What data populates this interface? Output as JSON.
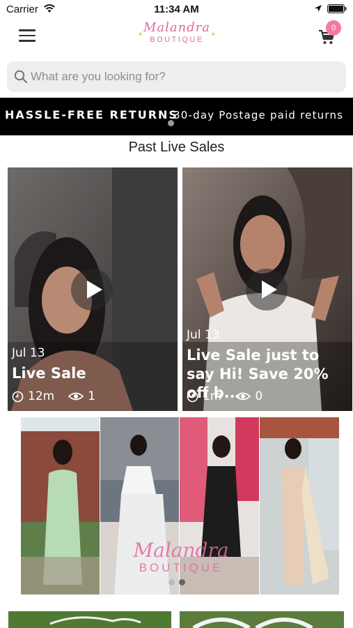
{
  "status": {
    "carrier": "Carrier",
    "time": "11:34 AM"
  },
  "header": {
    "logo_script": "Malandra",
    "logo_word": "BOUTIQUE",
    "cart_count": "0"
  },
  "search": {
    "placeholder": "What are you looking for?"
  },
  "banner": {
    "headline": "HASSLE-FREE RETURNS",
    "subline": "30-day Postage paid returns"
  },
  "section": {
    "title": "Past Live Sales"
  },
  "live_sales": [
    {
      "date": "Jul 13",
      "title": "Live Sale",
      "duration": "12m",
      "views": "1"
    },
    {
      "date": "Jul 13",
      "title": "Live Sale just to say Hi! Save 20% off b...",
      "duration": "1m",
      "views": "0"
    }
  ],
  "promo": {
    "watermark_script": "Malandra",
    "watermark_word": "BOUTIQUE",
    "dress_colors": [
      "#b7dcb4",
      "#f5f5f5",
      "#1c1c1c",
      "#e8cdb6"
    ]
  },
  "icons": [
    "wifi-icon",
    "location-arrow-icon",
    "battery-icon",
    "hamburger-menu-icon",
    "cart-icon",
    "search-icon",
    "play-icon",
    "clock-icon",
    "eye-icon"
  ]
}
